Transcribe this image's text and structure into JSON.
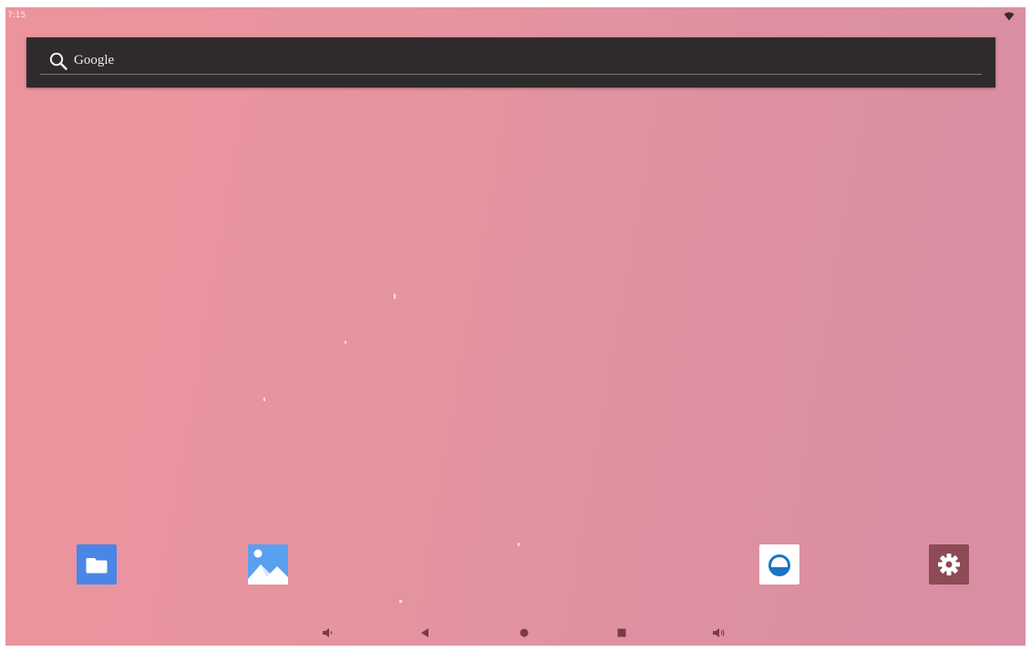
{
  "status_bar": {
    "time": "7:15",
    "icons": [
      "wifi-icon"
    ]
  },
  "search_widget": {
    "label": "Google",
    "icon": "search-icon"
  },
  "dock": {
    "apps": [
      {
        "icon": "folder-icon",
        "color": "#4a86e8"
      },
      {
        "icon": "image-icon",
        "color": "#5aa0f0"
      },
      {
        "icon": "vpn-icon",
        "color": "#1a73c8"
      },
      {
        "icon": "gear-icon",
        "color": "#8e4a55"
      }
    ]
  },
  "navigation_bar": {
    "buttons": [
      "volume-down-icon",
      "back-icon",
      "home-icon",
      "recents-icon",
      "volume-up-icon"
    ]
  },
  "wallpaper": {
    "colors": [
      "#ec949c",
      "#d98ea3"
    ]
  }
}
